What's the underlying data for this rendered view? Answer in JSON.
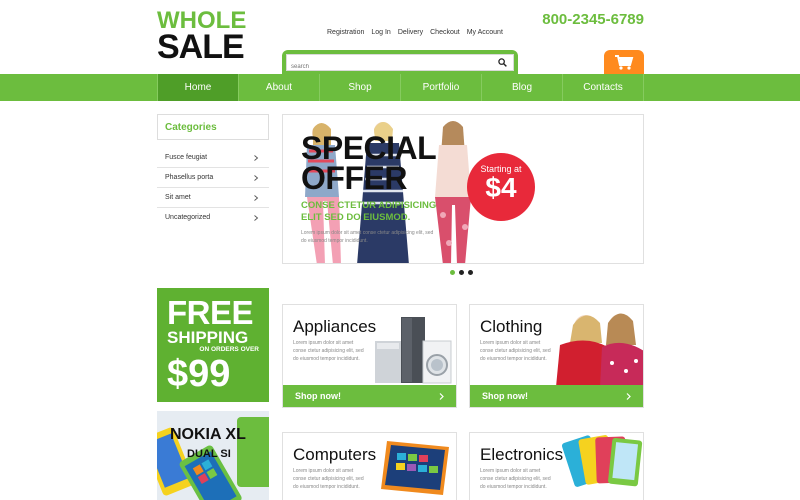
{
  "logo": {
    "line1": "WHOLE",
    "line2": "SALE"
  },
  "top_links": [
    "Registration",
    "Log In",
    "Delivery",
    "Checkout",
    "My Account"
  ],
  "phone": "800-2345-6789",
  "search": {
    "placeholder": "search"
  },
  "nav": [
    "Home",
    "About",
    "Shop",
    "Portfolio",
    "Blog",
    "Contacts"
  ],
  "categories": {
    "title": "Categories",
    "items": [
      "Fusce feugiat",
      "Phasellus porta",
      "Sit amet",
      "Uncategorized"
    ]
  },
  "slider": {
    "title_line1": "SPECIAL",
    "title_line2": "OFFER",
    "subtitle_line1": "CONSE CTETUR ADIPISICING",
    "subtitle_line2": "ELIT SED DO EIUSMOD.",
    "text": "Lorem ipsum dolor sit amet conse ctetur adipisicing elit, sed do eiusmod tempor incididunt.",
    "badge_top": "Starting at",
    "badge_price": "$4"
  },
  "promo": {
    "line1": "FREE",
    "line2": "SHIPPING",
    "line3": "ON ORDERS OVER",
    "line4": "$99"
  },
  "nokia": {
    "line1": "NOKIA XL",
    "line2": "DUAL SI"
  },
  "products": [
    {
      "title": "Appliances",
      "desc": "Lorem ipsum dolor sit amet conse ctetur adipisicing elit, sed do eiusmod tempor incididunt.",
      "button": "Shop now!"
    },
    {
      "title": "Clothing",
      "desc": "Lorem ipsum dolor sit amet conse ctetur adipisicing elit, sed do eiusmod tempor incididunt.",
      "button": "Shop now!"
    },
    {
      "title": "Computers",
      "desc": "Lorem ipsum dolor sit amet conse ctetur adipisicing elit, sed do eiusmod tempor incididunt."
    },
    {
      "title": "Electronics",
      "desc": "Lorem ipsum dolor sit amet conse ctetur adipisicing elit, sed do eiusmod tempor incididunt."
    }
  ],
  "colors": {
    "brand_green": "#6cbd3e",
    "dark_green": "#4f9e28",
    "cart_orange": "#ff8a1e",
    "badge_red": "#e8293a"
  }
}
